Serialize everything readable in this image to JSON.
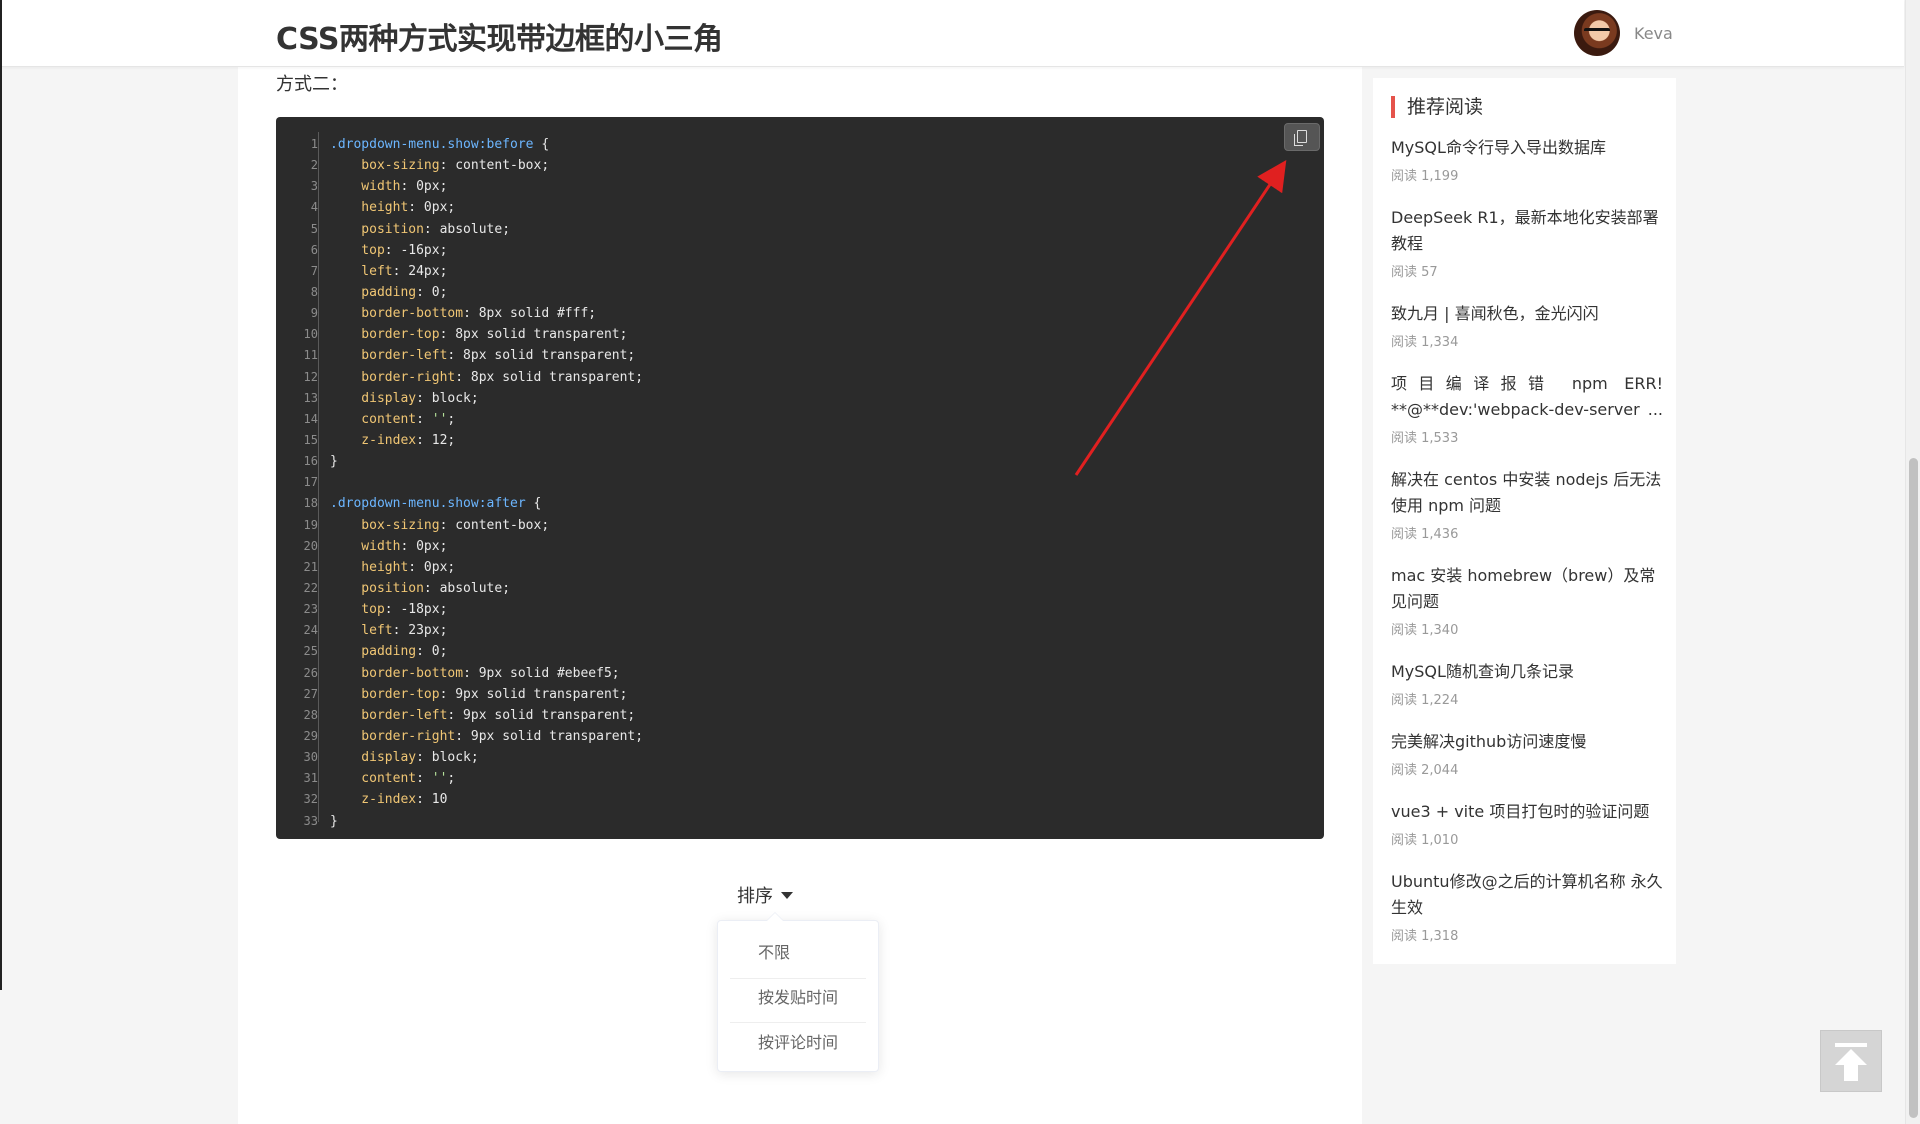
{
  "header": {
    "title": "CSS两种方式实现带边框的小三角",
    "username": "Keva"
  },
  "article": {
    "section_label": "方式二：",
    "code_lines": [
      [
        {
          "t": ".dropdown-menu.show:before",
          "c": "sel"
        },
        {
          "t": " {",
          "c": "val"
        }
      ],
      [
        {
          "t": "    box-sizing",
          "c": "prop"
        },
        {
          "t": ": content-box;",
          "c": "val"
        }
      ],
      [
        {
          "t": "    width",
          "c": "prop"
        },
        {
          "t": ": 0px;",
          "c": "val"
        }
      ],
      [
        {
          "t": "    height",
          "c": "prop"
        },
        {
          "t": ": 0px;",
          "c": "val"
        }
      ],
      [
        {
          "t": "    position",
          "c": "prop"
        },
        {
          "t": ": absolute;",
          "c": "val"
        }
      ],
      [
        {
          "t": "    top",
          "c": "prop"
        },
        {
          "t": ": -16px;",
          "c": "val"
        }
      ],
      [
        {
          "t": "    left",
          "c": "prop"
        },
        {
          "t": ": 24px;",
          "c": "val"
        }
      ],
      [
        {
          "t": "    padding",
          "c": "prop"
        },
        {
          "t": ": 0;",
          "c": "val"
        }
      ],
      [
        {
          "t": "    border-bottom",
          "c": "prop"
        },
        {
          "t": ": 8px solid #fff;",
          "c": "val"
        }
      ],
      [
        {
          "t": "    border-top",
          "c": "prop"
        },
        {
          "t": ": 8px solid transparent;",
          "c": "val"
        }
      ],
      [
        {
          "t": "    border-left",
          "c": "prop"
        },
        {
          "t": ": 8px solid transparent;",
          "c": "val"
        }
      ],
      [
        {
          "t": "    border-right",
          "c": "prop"
        },
        {
          "t": ": 8px solid transparent;",
          "c": "val"
        }
      ],
      [
        {
          "t": "    display",
          "c": "prop"
        },
        {
          "t": ": block;",
          "c": "val"
        }
      ],
      [
        {
          "t": "    content",
          "c": "prop"
        },
        {
          "t": ": ",
          "c": "val"
        },
        {
          "t": "''",
          "c": "str"
        },
        {
          "t": ";",
          "c": "val"
        }
      ],
      [
        {
          "t": "    z-index",
          "c": "prop"
        },
        {
          "t": ": 12;",
          "c": "val"
        }
      ],
      [
        {
          "t": "}",
          "c": "val"
        }
      ],
      [
        {
          "t": "",
          "c": "val"
        }
      ],
      [
        {
          "t": ".dropdown-menu.show:after",
          "c": "sel"
        },
        {
          "t": " {",
          "c": "val"
        }
      ],
      [
        {
          "t": "    box-sizing",
          "c": "prop"
        },
        {
          "t": ": content-box;",
          "c": "val"
        }
      ],
      [
        {
          "t": "    width",
          "c": "prop"
        },
        {
          "t": ": 0px;",
          "c": "val"
        }
      ],
      [
        {
          "t": "    height",
          "c": "prop"
        },
        {
          "t": ": 0px;",
          "c": "val"
        }
      ],
      [
        {
          "t": "    position",
          "c": "prop"
        },
        {
          "t": ": absolute;",
          "c": "val"
        }
      ],
      [
        {
          "t": "    top",
          "c": "prop"
        },
        {
          "t": ": -18px;",
          "c": "val"
        }
      ],
      [
        {
          "t": "    left",
          "c": "prop"
        },
        {
          "t": ": 23px;",
          "c": "val"
        }
      ],
      [
        {
          "t": "    padding",
          "c": "prop"
        },
        {
          "t": ": 0;",
          "c": "val"
        }
      ],
      [
        {
          "t": "    border-bottom",
          "c": "prop"
        },
        {
          "t": ": 9px solid #ebeef5;",
          "c": "val"
        }
      ],
      [
        {
          "t": "    border-top",
          "c": "prop"
        },
        {
          "t": ": 9px solid transparent;",
          "c": "val"
        }
      ],
      [
        {
          "t": "    border-left",
          "c": "prop"
        },
        {
          "t": ": 9px solid transparent;",
          "c": "val"
        }
      ],
      [
        {
          "t": "    border-right",
          "c": "prop"
        },
        {
          "t": ": 9px solid transparent;",
          "c": "val"
        }
      ],
      [
        {
          "t": "    display",
          "c": "prop"
        },
        {
          "t": ": block;",
          "c": "val"
        }
      ],
      [
        {
          "t": "    content",
          "c": "prop"
        },
        {
          "t": ": ",
          "c": "val"
        },
        {
          "t": "''",
          "c": "str"
        },
        {
          "t": ";",
          "c": "val"
        }
      ],
      [
        {
          "t": "    z-index",
          "c": "prop"
        },
        {
          "t": ": 10",
          "c": "val"
        }
      ],
      [
        {
          "t": "}",
          "c": "val"
        }
      ]
    ],
    "copy_icon": "copy-icon",
    "arrow_color": "#e02020"
  },
  "sort": {
    "label": "排序",
    "options": [
      "不限",
      "按发贴时间",
      "按评论时间"
    ]
  },
  "sidebar": {
    "title": "推荐阅读",
    "accent": "#e5534b",
    "items": [
      {
        "title": "MySQL命令行导入导出数据库",
        "meta": "阅读 1,199"
      },
      {
        "title": "DeepSeek R1，最新本地化安装部署教程",
        "meta": "阅读 57"
      },
      {
        "title": "致九月 | 喜闻秋色，金光闪闪",
        "meta": "阅读 1,334"
      },
      {
        "title": "项目编译报错 npm ERR! **@**dev:'webpack-dev-server ...",
        "meta": "阅读 1,533"
      },
      {
        "title": "解决在 centos 中安装 nodejs 后无法使用 npm 问题",
        "meta": "阅读 1,436"
      },
      {
        "title": "mac 安装 homebrew（brew）及常见问题",
        "meta": "阅读 1,340"
      },
      {
        "title": "MySQL随机查询几条记录",
        "meta": "阅读 1,224"
      },
      {
        "title": "完美解决github访问速度慢",
        "meta": "阅读 2,044"
      },
      {
        "title": "vue3 + vite 项目打包时的验证问题",
        "meta": "阅读 1,010"
      },
      {
        "title": "Ubuntu修改@之后的计算机名称 永久生效",
        "meta": "阅读 1,318"
      }
    ]
  },
  "back_to_top_icon": "arrow-up-icon"
}
